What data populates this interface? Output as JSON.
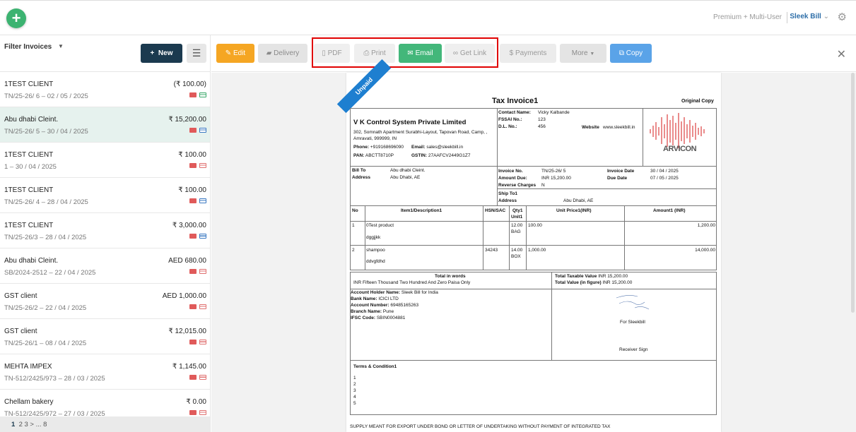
{
  "topbar": {
    "add_icon": "plus-icon",
    "plan": "Premium + Multi-User",
    "brand": "Sleek Bill",
    "brand_caret": "⌄",
    "settings_icon": "gear-icon"
  },
  "sidebar": {
    "filter_label": "Filter Invoices",
    "new_label": "New",
    "invoices": [
      {
        "client": "1TEST CLIENT",
        "number": "TN/25-26/ 6",
        "date": "02 / 05 / 2025",
        "amount": "(₹ 100.00)",
        "status": "green"
      },
      {
        "client": "Abu dhabi Cleint.",
        "number": "TN/25-26/ 5",
        "date": "30 / 04 / 2025",
        "amount": "₹ 15,200.00",
        "status": "blue"
      },
      {
        "client": "1TEST CLIENT",
        "number": "1",
        "date": "30 / 04 / 2025",
        "amount": "₹ 100.00",
        "status": "red"
      },
      {
        "client": "1TEST CLIENT",
        "number": "TN/25-26/ 4",
        "date": "28 / 04 / 2025",
        "amount": "₹ 100.00",
        "status": "blue"
      },
      {
        "client": "1TEST CLIENT",
        "number": "TN/25-26/3",
        "date": "28 / 04 / 2025",
        "amount": "₹ 3,000.00",
        "status": "blue"
      },
      {
        "client": "Abu dhabi Cleint.",
        "number": "SB/2024-2512",
        "date": "22 / 04 / 2025",
        "amount": "AED 680.00",
        "status": "red"
      },
      {
        "client": "GST client",
        "number": "TN/25-26/2",
        "date": "22 / 04 / 2025",
        "amount": "AED 1,000.00",
        "status": "red"
      },
      {
        "client": "GST client",
        "number": "TN/25-26/1",
        "date": "08 / 04 / 2025",
        "amount": "₹ 12,015.00",
        "status": "red"
      },
      {
        "client": "MEHTA IMPEX",
        "number": "TN-512/2425/973",
        "date": "28 / 03 / 2025",
        "amount": "₹ 1,145.00",
        "status": "red"
      },
      {
        "client": "Chellam bakery",
        "number": "TN-512/2425/972",
        "date": "27 / 03 / 2025",
        "amount": "₹ 0.00",
        "status": "red"
      }
    ],
    "pagination": {
      "current": "1",
      "rest": "2  3 >  ... 8"
    }
  },
  "toolbar": {
    "edit": "Edit",
    "delivery": "Delivery",
    "pdf": "PDF",
    "print": "Print",
    "email": "Email",
    "get_link": "Get Link",
    "payments": "Payments",
    "more": "More",
    "copy": "Copy"
  },
  "invoice": {
    "ribbon": "Unpaid",
    "title": "Tax Invoice1",
    "copy_type": "Original Copy",
    "company": "V K Control System Private Limited",
    "address_line1": "302, Somnath Apartment Surabhi-Layout, Tapovan Road, Camp, ,",
    "address_line2": "Amravati, 999999, IN",
    "phone_label": "Phone:",
    "phone": "+919168696090",
    "email_label": "Email:",
    "email": "sales@sleekbill.in",
    "pan_label": "PAN:",
    "pan": "ABCTT8710P",
    "gstin_label": "GSTIN:",
    "gstin": "27AAFCV2449G1Z7",
    "contact_label": "Contact Name:",
    "contact": "Vicky Kalbande",
    "fssai_label": "FSSAI No.:",
    "fssai": "123",
    "dl_label": "D.L. No.:",
    "dl": "456",
    "website_label": "Website",
    "website": "www.sleekbill.in",
    "logo_text": "ARVICON",
    "bill_to_label": "Bill To",
    "bill_to": "Abu dhabi Cleint.",
    "address_label": "Address",
    "bill_address": "Abu Dhabi, AE",
    "inv_no_label": "Invoice No.",
    "inv_no": "TN/25-26/ 5",
    "amount_due_label": "Amount Due:",
    "amount_due": "INR 15,200.00",
    "reverse_label": "Reverse Charges",
    "reverse": "N",
    "inv_date_label": "Invoice Date",
    "inv_date": "30 / 04 / 2025",
    "due_date_label": "Due Date",
    "due_date": "07 / 05 / 2025",
    "ship_to_label": "Ship To1",
    "ship_address_label": "Address",
    "ship_address": "Abu Dhabi, AE",
    "col_no": "No",
    "col_item": "Item1/Description1",
    "col_hsn": "HSN/SAC",
    "col_qty": "Qty1",
    "col_unit": "Unit1",
    "col_price": "Unit Price1(INR)",
    "col_amount": "Amount1 (INR)",
    "rows": [
      {
        "no": "1",
        "item": "0Test product",
        "desc": "dggjjkk",
        "hsn": "",
        "qty": "12.00",
        "unit": "BAG",
        "price": "100.00",
        "amount": "1,200.00"
      },
      {
        "no": "2",
        "item": "shampoo",
        "desc": "ddvgfdhd",
        "hsn": "34243",
        "qty": "14.00",
        "unit": "BOX",
        "price": "1,000.00",
        "amount": "14,000.00"
      }
    ],
    "words_label": "Total in words",
    "words": "INR Fifteen Thousand Two Hundred And Zero Paisa Only",
    "taxable_label": "Total Taxable Value",
    "taxable": "INR 15,200.00",
    "total_label": "Total Value (in figure)",
    "total": "INR 15,200.00",
    "acc_holder_label": "Account Holder Name:",
    "acc_holder": "Sleek Bill for India",
    "bank_label": "Bank Name:",
    "bank": "ICICI LTD",
    "acc_no_label": "Account Number:",
    "acc_no": "69485165263",
    "branch_label": "Branch Name:",
    "branch": "Pune",
    "ifsc_label": "IFSC Code:",
    "ifsc": "SBIN0004881",
    "for_label": "For Sleekbill",
    "receiver_label": "Receiver Sign",
    "terms_label": "Terms & Condition1",
    "terms": [
      "1",
      "2",
      "3",
      "4",
      "5"
    ],
    "footer": "SUPPLY MEANT FOR EXPORT UNDER BOND OR LETTER OF UNDERTAKING WITHOUT PAYMENT OF INTEGRATED TAX"
  },
  "colors": {
    "green": "#3cb371",
    "navy": "#1b3a4f",
    "orange": "#f5a623",
    "email_green": "#43b77a",
    "copy_blue": "#5aa3e8",
    "highlight_red": "#e00000"
  }
}
